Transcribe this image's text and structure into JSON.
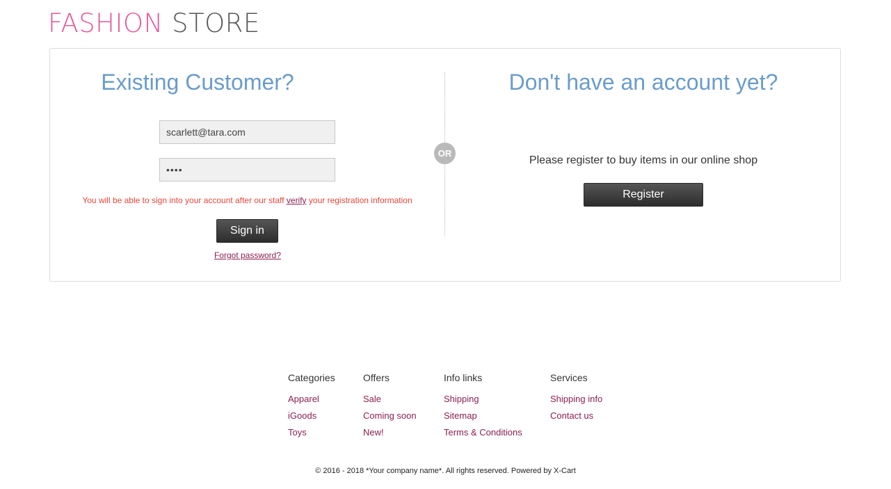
{
  "logo": {
    "part1": "FASHION",
    "part2": "STORE"
  },
  "login": {
    "heading": "Existing Customer?",
    "email_value": "scarlett@tara.com",
    "password_value": "••••",
    "notice_before": "You will be able to sign into your account after our staff",
    "notice_link": "verify",
    "notice_after": "your registration information",
    "signin_label": "Sign in",
    "forgot_label": "Forgot password?"
  },
  "divider": {
    "or_label": "OR"
  },
  "register": {
    "heading": "Don't have an account yet?",
    "text": "Please register to buy items in our online shop",
    "button_label": "Register"
  },
  "footer": {
    "columns": [
      {
        "title": "Categories",
        "items": [
          "Apparel",
          "iGoods",
          "Toys"
        ]
      },
      {
        "title": "Offers",
        "items": [
          "Sale",
          "Coming soon",
          "New!"
        ]
      },
      {
        "title": "Info links",
        "items": [
          "Shipping",
          "Sitemap",
          "Terms & Conditions"
        ]
      },
      {
        "title": "Services",
        "items": [
          "Shipping info",
          "Contact us"
        ]
      }
    ],
    "copyright": "© 2016 - 2018 *Your company name*. All rights reserved. Powered by X-Cart"
  },
  "colors": {
    "brand_pink": "#e8569a",
    "heading_blue": "#6a9cc9",
    "link": "#8b1f4f",
    "notice_red": "#e5463a"
  }
}
